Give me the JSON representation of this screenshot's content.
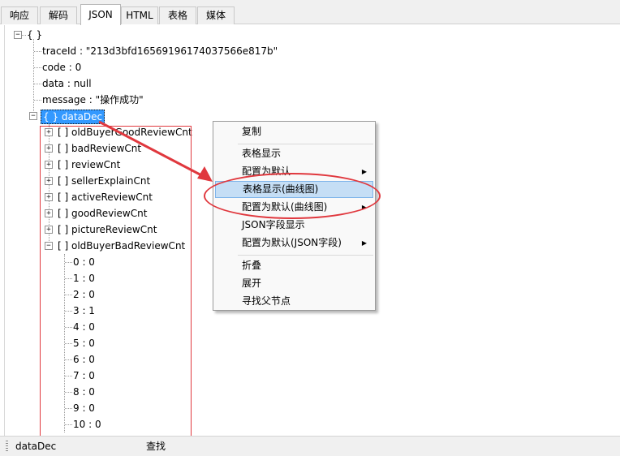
{
  "tabs": [
    "响应",
    "解码",
    "JSON",
    "HTML",
    "表格",
    "媒体"
  ],
  "active_tab": "JSON",
  "tree": {
    "root_label": "{ }",
    "fields": [
      "traceId : \"213d3bfd16569196174037566e817b\"",
      "code : 0",
      "data : null",
      "message : \"操作成功\""
    ],
    "selected_node": "{ } dataDec",
    "children": [
      "[ ] oldBuyerGoodReviewCnt",
      "[ ] badReviewCnt",
      "[ ] reviewCnt",
      "[ ] sellerExplainCnt",
      "[ ] activeReviewCnt",
      "[ ] goodReviewCnt",
      "[ ] pictureReviewCnt",
      "[ ] oldBuyerBadReviewCnt"
    ],
    "leaf_values": [
      "0 : 0",
      "1 : 0",
      "2 : 0",
      "3 : 1",
      "4 : 0",
      "5 : 0",
      "6 : 0",
      "7 : 0",
      "8 : 0",
      "9 : 0",
      "10 : 0"
    ],
    "expand_glyph": "+",
    "collapse_glyph": "−"
  },
  "context_menu": {
    "items": [
      "复制",
      "表格显示",
      "配置为默认",
      "表格显示(曲线图)",
      "配置为默认(曲线图)",
      "JSON字段显示",
      "配置为默认(JSON字段)",
      "折叠",
      "展开",
      "寻找父节点"
    ],
    "highlighted": "表格显示(曲线图)",
    "submenu_arrow": "▶"
  },
  "annotations": {
    "color": "#e0383e"
  },
  "status_bar": {
    "path": "dataDec",
    "find_label": "查找"
  },
  "colors": {
    "selection": "#3399ff",
    "menu_highlight": "#c5def5"
  }
}
